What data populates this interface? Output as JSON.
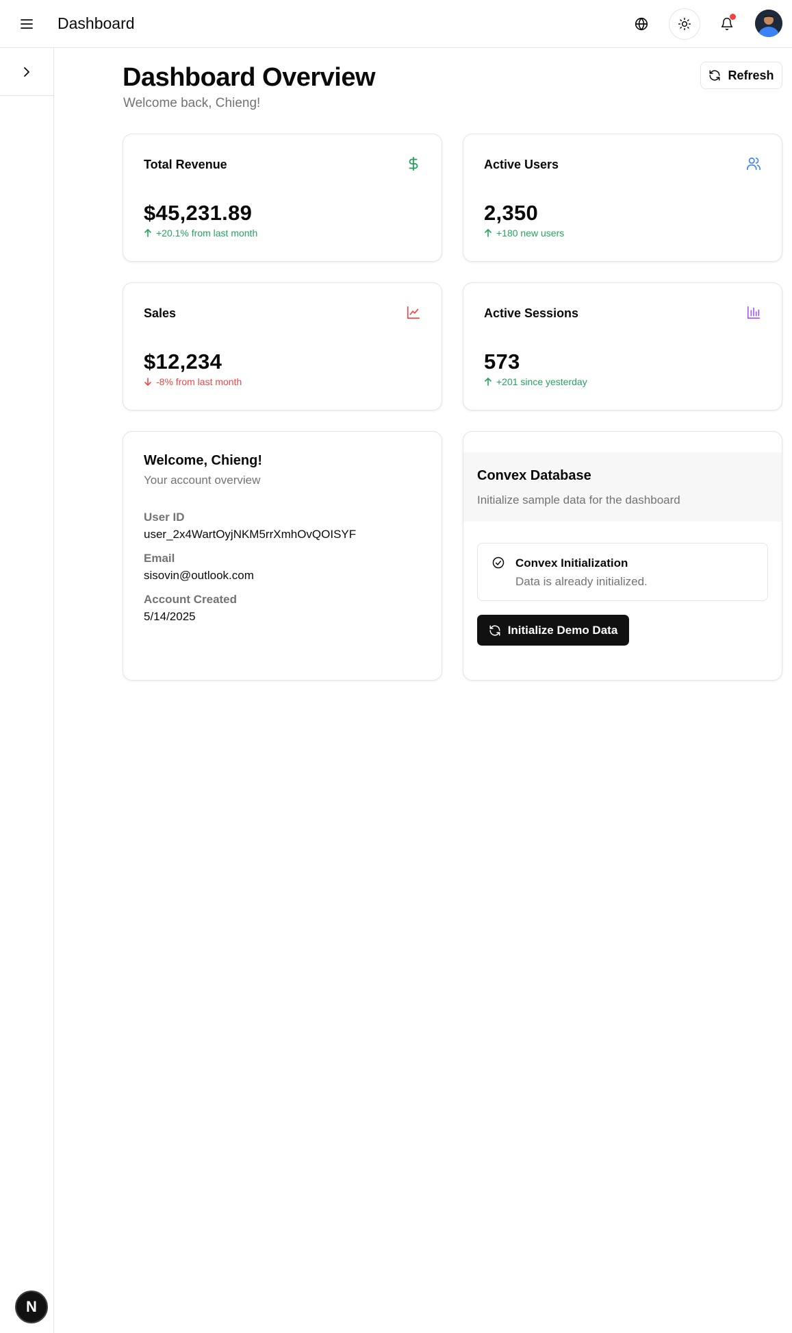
{
  "header": {
    "title": "Dashboard",
    "icons": {
      "menu": "hamburger-menu-icon",
      "language": "globe-icon",
      "theme": "sun-icon",
      "notifications": "bell-icon"
    },
    "notification_dot_color": "#ef4444"
  },
  "sidebar": {
    "toggle_icon": "chevron-right-icon",
    "badge_label": "N"
  },
  "main": {
    "title": "Dashboard Overview",
    "subtitle": "Welcome back, Chieng!",
    "refresh_label": "Refresh"
  },
  "stats": [
    {
      "title": "Total Revenue",
      "value": "$45,231.89",
      "change": "+20.1% from last month",
      "trend": "up",
      "icon": "dollar-icon",
      "icon_color": "#22a45d"
    },
    {
      "title": "Active Users",
      "value": "2,350",
      "change": "+180 new users",
      "trend": "up",
      "icon": "users-icon",
      "icon_color": "#3b82f6"
    },
    {
      "title": "Sales",
      "value": "$12,234",
      "change": "-8% from last month",
      "trend": "down",
      "icon": "line-chart-icon",
      "icon_color": "#ef4444"
    },
    {
      "title": "Active Sessions",
      "value": "573",
      "change": "+201 since yesterday",
      "trend": "up",
      "icon": "bar-chart-icon",
      "icon_color": "#a855f7"
    }
  ],
  "welcome": {
    "title": "Welcome, Chieng!",
    "subtitle": "Your account overview",
    "user_id_label": "User ID",
    "user_id": "user_2x4WartOyjNKM5rrXmhOvQOISYF",
    "email_label": "Email",
    "email": "sisovin@outlook.com",
    "created_label": "Account Created",
    "created": "5/14/2025"
  },
  "convex": {
    "title": "Convex Database",
    "description": "Initialize sample data for the dashboard",
    "status_title": "Convex Initialization",
    "status_desc": "Data is already initialized.",
    "button_label": "Initialize Demo Data"
  },
  "colors": {
    "accent_dark": "#111111",
    "muted_text": "#737373",
    "up": "#22a45d",
    "down": "#ef4444"
  }
}
